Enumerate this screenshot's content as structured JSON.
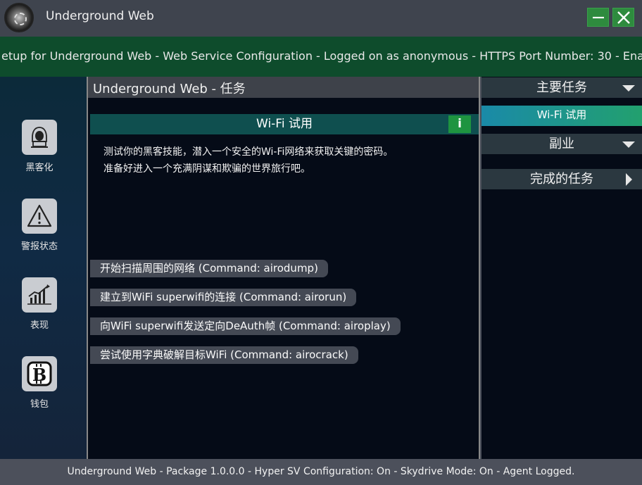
{
  "window": {
    "title": "Underground Web",
    "minimize_icon": "minimize-icon",
    "close_icon": "close-icon"
  },
  "marquee": {
    "text": "etup for Underground Web - Web Service Configuration - Logged on as anonymous - HTTPS Port Number: 30 - Enal"
  },
  "sidebar": {
    "items": [
      {
        "label": "黑客化",
        "icon": "hacker-icon"
      },
      {
        "label": "警报状态",
        "icon": "warning-icon"
      },
      {
        "label": "表现",
        "icon": "performance-chart-icon"
      },
      {
        "label": "钱包",
        "icon": "wallet-bitcoin-icon"
      }
    ]
  },
  "center": {
    "header": "Underground Web - 任务",
    "mission_title": "Wi-Fi 试用",
    "info_label": "i",
    "description_lines": [
      "测试你的黑客技能，潜入一个安全的Wi-Fi网络来获取关键的密码。",
      "准备好进入一个充满阴谋和欺骗的世界旅行吧。"
    ],
    "commands": [
      "开始扫描周围的网络 (Command: airodump)",
      "建立到WiFi superwifi的连接 (Command: airorun)",
      "向WiFi superwifi发送定向DeAuth帧 (Command: airoplay)",
      "尝试使用字典破解目标WiFi (Command: airocrack)"
    ]
  },
  "right": {
    "main_tasks": "主要任务",
    "main_tasks_item": "Wi-Fi 试用",
    "side_tasks": "副业",
    "completed_tasks": "完成的任务"
  },
  "footer": {
    "text": "Underground Web - Package 1.0.0.0 - Hyper SV Configuration: On - Skydrive Mode: On - Agent Logged."
  }
}
